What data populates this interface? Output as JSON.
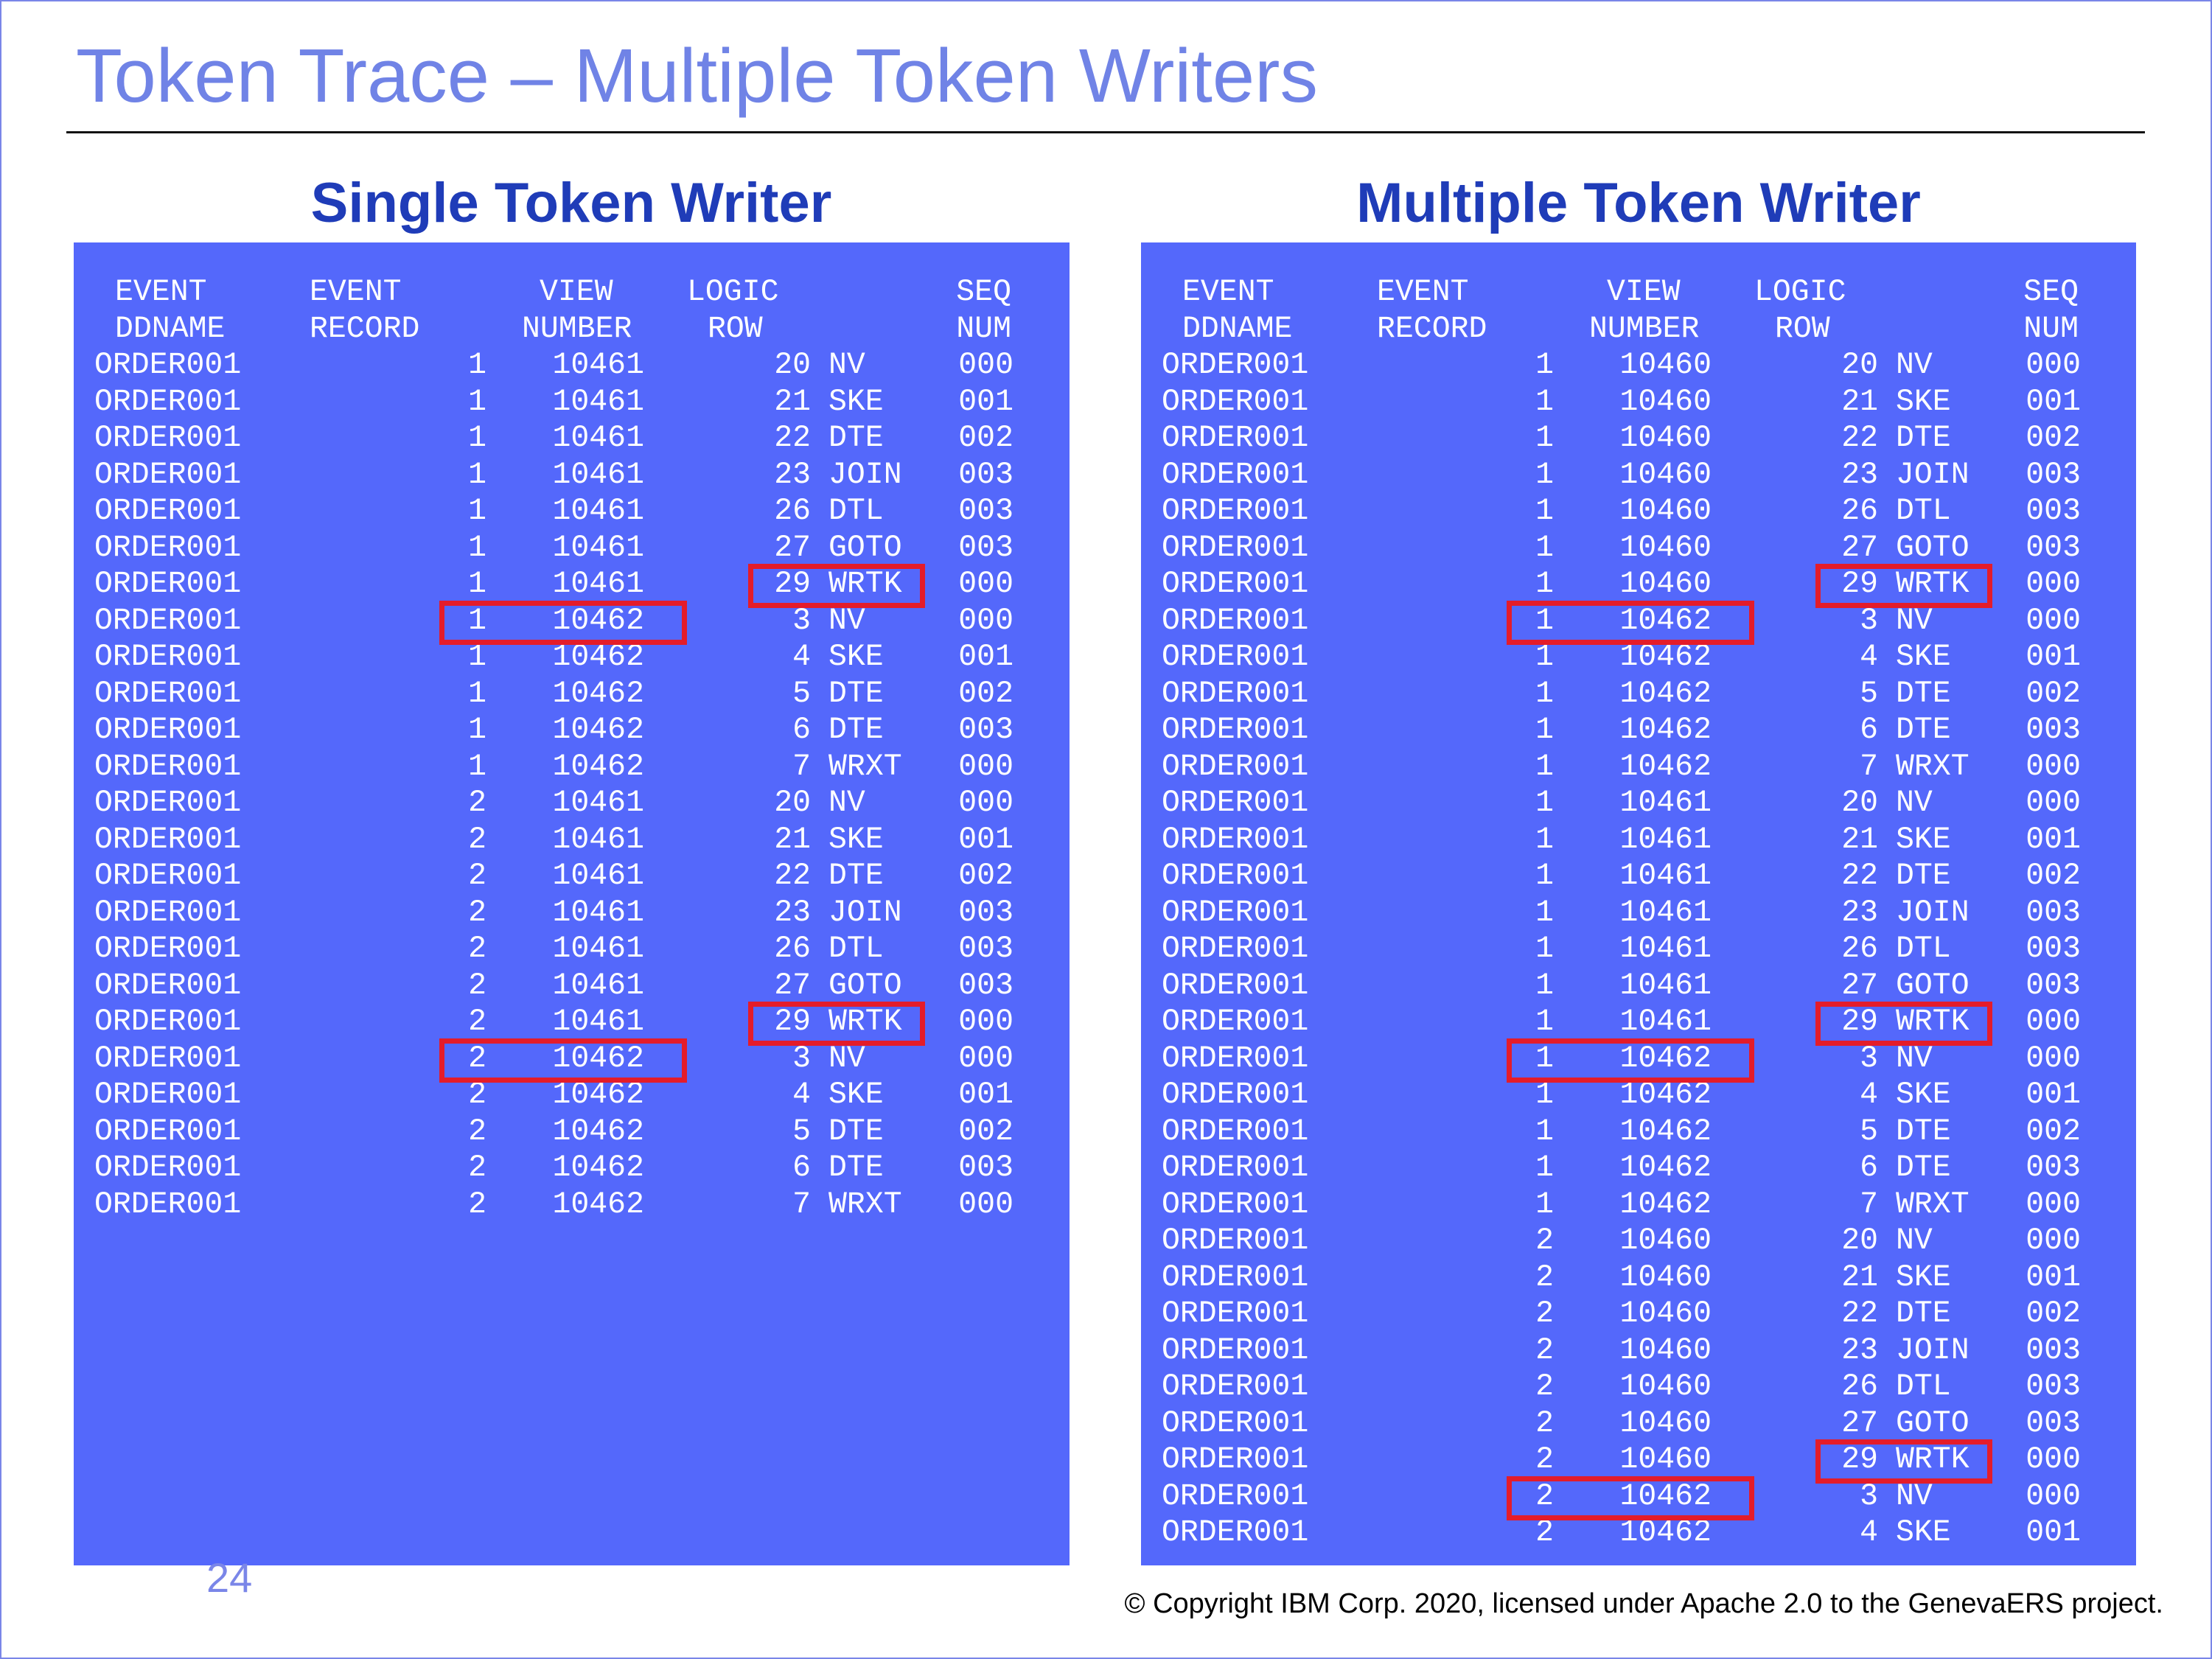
{
  "title": "Token Trace – Multiple Token Writers",
  "page_number": "24",
  "copyright": "© Copyright IBM Corp. 2020, licensed under Apache 2.0 to the GenevaERS project.",
  "panels": [
    {
      "id": "single",
      "subtitle": "Single Token Writer",
      "headers": [
        [
          "EVENT",
          "DDNAME"
        ],
        [
          "EVENT",
          "RECORD"
        ],
        [
          "VIEW",
          "NUMBER"
        ],
        [
          "LOGIC",
          "ROW"
        ],
        [
          "",
          ""
        ],
        [
          "SEQ",
          "NUM"
        ]
      ],
      "rows": [
        [
          "ORDER001",
          "1",
          "10461",
          "20",
          "NV",
          "000"
        ],
        [
          "ORDER001",
          "1",
          "10461",
          "21",
          "SKE",
          "001"
        ],
        [
          "ORDER001",
          "1",
          "10461",
          "22",
          "DTE",
          "002"
        ],
        [
          "ORDER001",
          "1",
          "10461",
          "23",
          "JOIN",
          "003"
        ],
        [
          "ORDER001",
          "1",
          "10461",
          "26",
          "DTL",
          "003"
        ],
        [
          "ORDER001",
          "1",
          "10461",
          "27",
          "GOTO",
          "003"
        ],
        [
          "ORDER001",
          "1",
          "10461",
          "29",
          "WRTK",
          "000"
        ],
        [
          "ORDER001",
          "1",
          "10462",
          "3",
          "NV",
          "000"
        ],
        [
          "ORDER001",
          "1",
          "10462",
          "4",
          "SKE",
          "001"
        ],
        [
          "ORDER001",
          "1",
          "10462",
          "5",
          "DTE",
          "002"
        ],
        [
          "ORDER001",
          "1",
          "10462",
          "6",
          "DTE",
          "003"
        ],
        [
          "ORDER001",
          "1",
          "10462",
          "7",
          "WRXT",
          "000"
        ],
        [
          "ORDER001",
          "2",
          "10461",
          "20",
          "NV",
          "000"
        ],
        [
          "ORDER001",
          "2",
          "10461",
          "21",
          "SKE",
          "001"
        ],
        [
          "ORDER001",
          "2",
          "10461",
          "22",
          "DTE",
          "002"
        ],
        [
          "ORDER001",
          "2",
          "10461",
          "23",
          "JOIN",
          "003"
        ],
        [
          "ORDER001",
          "2",
          "10461",
          "26",
          "DTL",
          "003"
        ],
        [
          "ORDER001",
          "2",
          "10461",
          "27",
          "GOTO",
          "003"
        ],
        [
          "ORDER001",
          "2",
          "10461",
          "29",
          "WRTK",
          "000"
        ],
        [
          "ORDER001",
          "2",
          "10462",
          "3",
          "NV",
          "000"
        ],
        [
          "ORDER001",
          "2",
          "10462",
          "4",
          "SKE",
          "001"
        ],
        [
          "ORDER001",
          "2",
          "10462",
          "5",
          "DTE",
          "002"
        ],
        [
          "ORDER001",
          "2",
          "10462",
          "6",
          "DTE",
          "003"
        ],
        [
          "ORDER001",
          "2",
          "10462",
          "7",
          "WRXT",
          "000"
        ]
      ],
      "highlights": [
        {
          "row": 6,
          "box": "logic"
        },
        {
          "row": 7,
          "box": "view"
        },
        {
          "row": 18,
          "box": "logic"
        },
        {
          "row": 19,
          "box": "view"
        }
      ]
    },
    {
      "id": "multiple",
      "subtitle": "Multiple Token Writer",
      "headers": [
        [
          "EVENT",
          "DDNAME"
        ],
        [
          "EVENT",
          "RECORD"
        ],
        [
          "VIEW",
          "NUMBER"
        ],
        [
          "LOGIC",
          "ROW"
        ],
        [
          "",
          ""
        ],
        [
          "SEQ",
          "NUM"
        ]
      ],
      "rows": [
        [
          "ORDER001",
          "1",
          "10460",
          "20",
          "NV",
          "000"
        ],
        [
          "ORDER001",
          "1",
          "10460",
          "21",
          "SKE",
          "001"
        ],
        [
          "ORDER001",
          "1",
          "10460",
          "22",
          "DTE",
          "002"
        ],
        [
          "ORDER001",
          "1",
          "10460",
          "23",
          "JOIN",
          "003"
        ],
        [
          "ORDER001",
          "1",
          "10460",
          "26",
          "DTL",
          "003"
        ],
        [
          "ORDER001",
          "1",
          "10460",
          "27",
          "GOTO",
          "003"
        ],
        [
          "ORDER001",
          "1",
          "10460",
          "29",
          "WRTK",
          "000"
        ],
        [
          "ORDER001",
          "1",
          "10462",
          "3",
          "NV",
          "000"
        ],
        [
          "ORDER001",
          "1",
          "10462",
          "4",
          "SKE",
          "001"
        ],
        [
          "ORDER001",
          "1",
          "10462",
          "5",
          "DTE",
          "002"
        ],
        [
          "ORDER001",
          "1",
          "10462",
          "6",
          "DTE",
          "003"
        ],
        [
          "ORDER001",
          "1",
          "10462",
          "7",
          "WRXT",
          "000"
        ],
        [
          "ORDER001",
          "1",
          "10461",
          "20",
          "NV",
          "000"
        ],
        [
          "ORDER001",
          "1",
          "10461",
          "21",
          "SKE",
          "001"
        ],
        [
          "ORDER001",
          "1",
          "10461",
          "22",
          "DTE",
          "002"
        ],
        [
          "ORDER001",
          "1",
          "10461",
          "23",
          "JOIN",
          "003"
        ],
        [
          "ORDER001",
          "1",
          "10461",
          "26",
          "DTL",
          "003"
        ],
        [
          "ORDER001",
          "1",
          "10461",
          "27",
          "GOTO",
          "003"
        ],
        [
          "ORDER001",
          "1",
          "10461",
          "29",
          "WRTK",
          "000"
        ],
        [
          "ORDER001",
          "1",
          "10462",
          "3",
          "NV",
          "000"
        ],
        [
          "ORDER001",
          "1",
          "10462",
          "4",
          "SKE",
          "001"
        ],
        [
          "ORDER001",
          "1",
          "10462",
          "5",
          "DTE",
          "002"
        ],
        [
          "ORDER001",
          "1",
          "10462",
          "6",
          "DTE",
          "003"
        ],
        [
          "ORDER001",
          "1",
          "10462",
          "7",
          "WRXT",
          "000"
        ],
        [
          "ORDER001",
          "2",
          "10460",
          "20",
          "NV",
          "000"
        ],
        [
          "ORDER001",
          "2",
          "10460",
          "21",
          "SKE",
          "001"
        ],
        [
          "ORDER001",
          "2",
          "10460",
          "22",
          "DTE",
          "002"
        ],
        [
          "ORDER001",
          "2",
          "10460",
          "23",
          "JOIN",
          "003"
        ],
        [
          "ORDER001",
          "2",
          "10460",
          "26",
          "DTL",
          "003"
        ],
        [
          "ORDER001",
          "2",
          "10460",
          "27",
          "GOTO",
          "003"
        ],
        [
          "ORDER001",
          "2",
          "10460",
          "29",
          "WRTK",
          "000"
        ],
        [
          "ORDER001",
          "2",
          "10462",
          "3",
          "NV",
          "000"
        ],
        [
          "ORDER001",
          "2",
          "10462",
          "4",
          "SKE",
          "001"
        ]
      ],
      "highlights": [
        {
          "row": 6,
          "box": "logic"
        },
        {
          "row": 7,
          "box": "view"
        },
        {
          "row": 18,
          "box": "logic"
        },
        {
          "row": 19,
          "box": "view"
        },
        {
          "row": 30,
          "box": "logic"
        },
        {
          "row": 31,
          "box": "view"
        }
      ]
    }
  ],
  "colors": {
    "panel_bg": "#5468fb",
    "title": "#7083e6",
    "subtitle": "#1f3cb8",
    "highlight": "#e41c2a"
  }
}
